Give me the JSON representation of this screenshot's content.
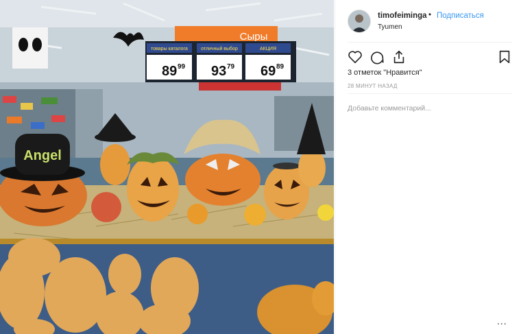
{
  "post": {
    "username": "timofeiminga",
    "separator": "•",
    "follow_label": "Подписаться",
    "location": "Tyumen",
    "likes_text": "3 отметок \"Нравится\"",
    "time_text": "28 МИНУТ НАЗАД",
    "comment_placeholder": "Добавьте комментарий...",
    "more_label": "..."
  },
  "photo": {
    "sign_text": "Сыры",
    "prices": [
      "89",
      "99",
      "93",
      "79",
      "69",
      "89"
    ],
    "price_tags": [
      "товары каталога",
      "отличный выбор",
      "АКЦИЯ"
    ],
    "hat_text": "Angel"
  },
  "icons": [
    "heart-icon",
    "comment-icon",
    "share-icon",
    "bookmark-icon"
  ],
  "colors": {
    "accent": "#3897f0",
    "text": "#262626",
    "muted": "#999999"
  }
}
